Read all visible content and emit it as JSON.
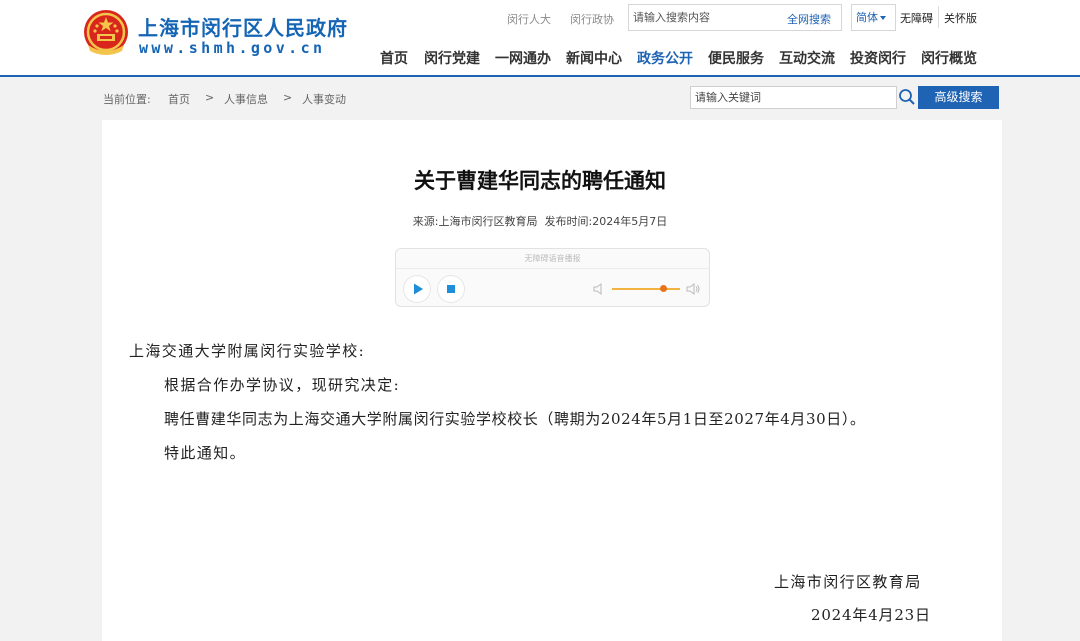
{
  "header": {
    "site_name": "上海市闵行区人民政府",
    "site_url": "www.shmh.gov.cn",
    "top_links": [
      "闵行人大",
      "闵行政协"
    ],
    "search": {
      "placeholder": "请输入搜索内容",
      "button_label": "全网搜索"
    },
    "language_selected": "简体",
    "tools": [
      "无障碍",
      "关怀版"
    ],
    "nav": [
      "首页",
      "闵行党建",
      "一网通办",
      "新闻中心",
      "政务公开",
      "便民服务",
      "互动交流",
      "投资闵行",
      "闵行概览"
    ],
    "nav_active": "政务公开",
    "accent_color": "#1f63b4"
  },
  "breadcrumb": {
    "label": "当前位置:",
    "separator": ">",
    "items": [
      "首页",
      "人事信息",
      "人事变动"
    ]
  },
  "keyword_search": {
    "placeholder": "请输入关键词",
    "button_label": "高级搜索"
  },
  "article": {
    "title": "关于曹建华同志的聘任通知",
    "source_label": "来源:",
    "source": "上海市闵行区教育局",
    "date_label": "发布时间:",
    "date": "2024年5月7日",
    "salutation": "上海交通大学附属闵行实验学校:",
    "paragraphs": [
      "根据合作办学协议，现研究决定:",
      "聘任曹建华同志为上海交通大学附属闵行实验学校校长（聘期为2024年5月1日至2027年4月30日）。",
      "特此通知。"
    ],
    "signature_org": "上海市闵行区教育局",
    "signature_date": "2024年4月23日"
  },
  "player": {
    "caption": "无障碍语音播报",
    "volume_level": 0.75,
    "icons": [
      "play-icon",
      "stop-icon",
      "volume-low-icon",
      "volume-high-icon"
    ]
  }
}
